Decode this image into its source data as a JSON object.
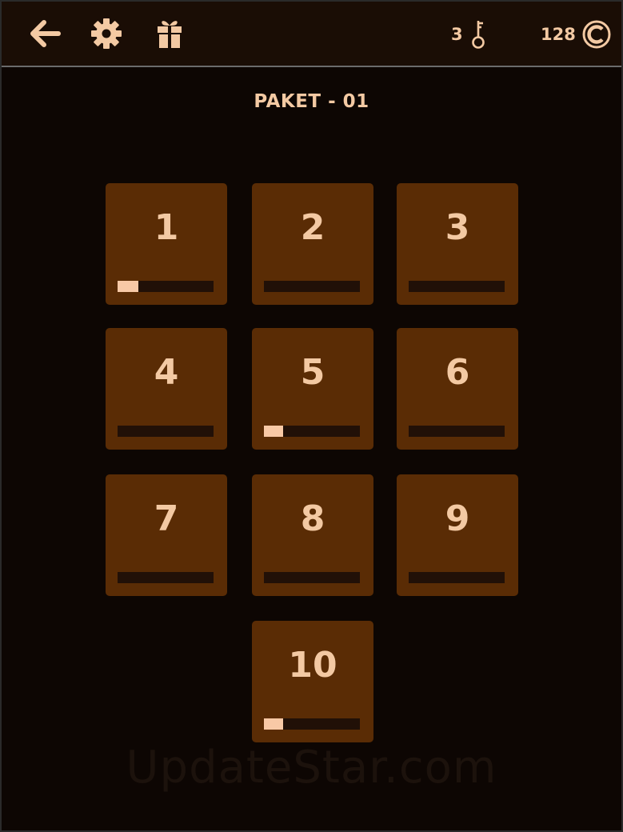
{
  "colors": {
    "background": "#0d0603",
    "topbar": "#1a0d05",
    "tile": "#5a2c05",
    "text": "#f3c9a3",
    "bar_track": "#211007",
    "bar_fill": "#f8c9a6"
  },
  "header": {
    "back_icon": "arrow-left-icon",
    "settings_icon": "gear-icon",
    "gift_icon": "gift-icon",
    "keys": {
      "count": "3",
      "icon": "key-icon"
    },
    "coins": {
      "count": "128",
      "icon": "coin-icon"
    }
  },
  "title": "PAKET - 01",
  "levels": [
    {
      "label": "1",
      "progress": 0.22
    },
    {
      "label": "2",
      "progress": 0
    },
    {
      "label": "3",
      "progress": 0
    },
    {
      "label": "4",
      "progress": 0
    },
    {
      "label": "5",
      "progress": 0.2
    },
    {
      "label": "6",
      "progress": 0
    },
    {
      "label": "7",
      "progress": 0
    },
    {
      "label": "8",
      "progress": 0
    },
    {
      "label": "9",
      "progress": 0
    },
    {
      "label": "10",
      "progress": 0.2
    }
  ],
  "watermark": "UpdateStar.com"
}
